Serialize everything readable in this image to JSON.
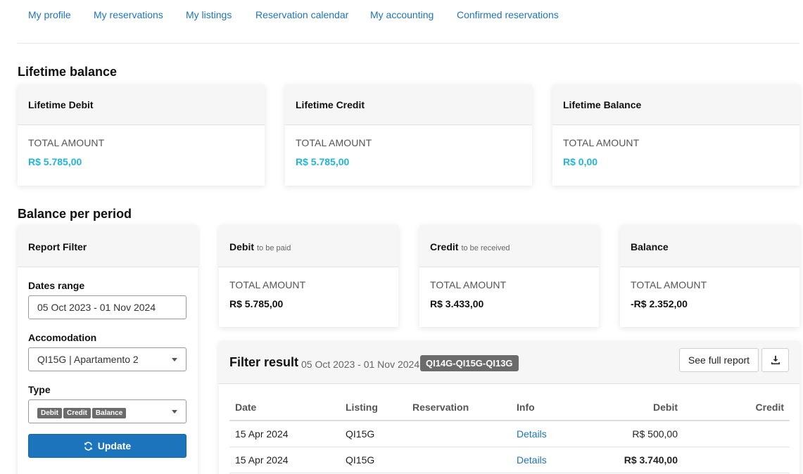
{
  "nav": {
    "items": [
      "My profile",
      "My reservations",
      "My listings",
      "Reservation calendar",
      "My accounting",
      "Confirmed reservations"
    ]
  },
  "lifetime": {
    "title": "Lifetime balance",
    "cards": [
      {
        "title": "Lifetime Debit",
        "label": "TOTAL AMOUNT",
        "amount": "R$ 5.785,00"
      },
      {
        "title": "Lifetime Credit",
        "label": "TOTAL AMOUNT",
        "amount": "R$ 5.785,00"
      },
      {
        "title": "Lifetime Balance",
        "label": "TOTAL AMOUNT",
        "amount": "R$ 0,00"
      }
    ],
    "amount_color": "#22b5d6"
  },
  "period": {
    "title": "Balance per period",
    "filter": {
      "title": "Report Filter",
      "dates_label": "Dates range",
      "dates_value": "05 Oct 2023 - 01 Nov 2024",
      "accommodation_label": "Accomodation",
      "accommodation_value": "QI15G | Apartamento 2",
      "type_label": "Type",
      "type_tags": [
        "Debit",
        "Credit",
        "Balance"
      ],
      "update_label": "Update",
      "update_icon": "refresh-icon",
      "update_color": "#1c74bc"
    },
    "cards": [
      {
        "title": "Debit",
        "subtitle": "to be paid",
        "label": "TOTAL AMOUNT",
        "amount": "R$ 5.785,00"
      },
      {
        "title": "Credit",
        "subtitle": "to be received",
        "label": "TOTAL AMOUNT",
        "amount": "R$ 3.433,00"
      },
      {
        "title": "Balance",
        "subtitle": "",
        "label": "TOTAL AMOUNT",
        "amount": "-R$ 2.352,00"
      }
    ]
  },
  "result": {
    "title": "Filter result",
    "range": "05 Oct 2023 - 01 Nov 2024",
    "tag": "QI14G-QI15G-QI13G",
    "full_report_label": "See full report",
    "download_icon": "download-icon",
    "columns": [
      "Date",
      "Listing",
      "Reservation",
      "Info",
      "Debit",
      "Credit"
    ],
    "rows": [
      {
        "date": "15 Apr 2024",
        "listing": "QI15G",
        "reservation": "",
        "info": "Details",
        "debit": "R$ 500,00",
        "credit": ""
      },
      {
        "date": "15 Apr 2024",
        "listing": "QI15G",
        "reservation": "",
        "info": "Details",
        "debit": "R$ 3.740,00",
        "credit": ""
      }
    ]
  }
}
